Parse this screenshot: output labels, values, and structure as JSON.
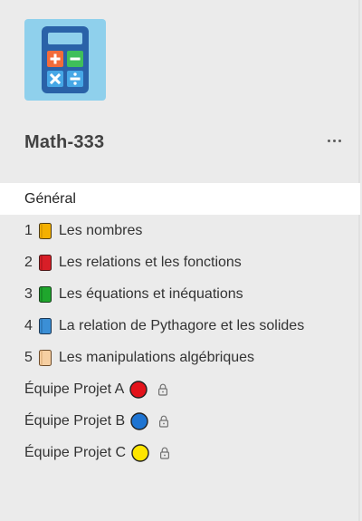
{
  "team": {
    "name": "Math-333",
    "avatar_icon": "calculator-icon",
    "avatar_bg": "#8fd0ec"
  },
  "channels": [
    {
      "label": "Général",
      "active": true
    },
    {
      "number": "1",
      "label": "Les nombres",
      "book_color": "#f4b000"
    },
    {
      "number": "2",
      "label": "Les relations et les fonctions",
      "book_color": "#d81e27"
    },
    {
      "number": "3",
      "label": "Les équations et inéquations",
      "book_color": "#1fa62d"
    },
    {
      "number": "4",
      "label": "La relation de Pythagore et les solides",
      "book_color": "#3b8fd6"
    },
    {
      "number": "5",
      "label": "Les manipulations algébriques",
      "book_color": "#f6cfa2"
    },
    {
      "label": "Équipe Projet A",
      "circle_color": "#e3131b",
      "private": true
    },
    {
      "label": "Équipe Projet B",
      "circle_color": "#1e74d2",
      "private": true
    },
    {
      "label": "Équipe Projet C",
      "circle_color": "#ffe600",
      "private": true
    }
  ]
}
